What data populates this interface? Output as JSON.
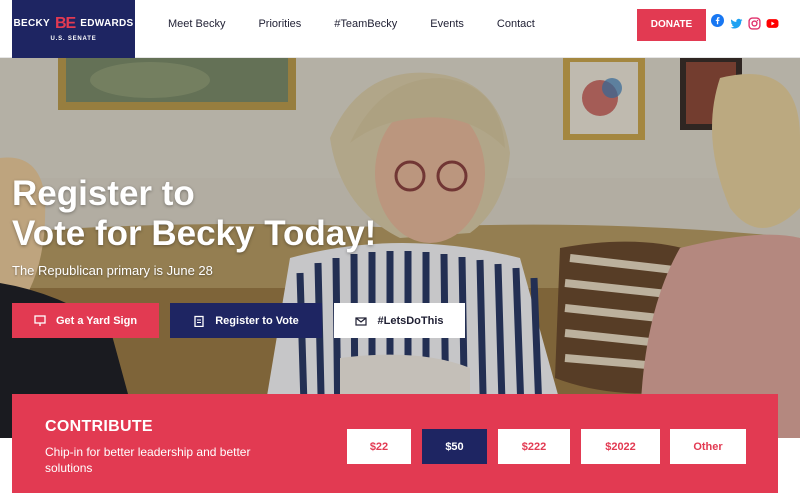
{
  "header": {
    "logo": {
      "first": "BECKY",
      "mark": "BE",
      "last": "EDWARDS",
      "sub": "U.S. SENATE"
    },
    "nav": [
      "Meet Becky",
      "Priorities",
      "#TeamBecky",
      "Events",
      "Contact"
    ],
    "donate_label": "DONATE",
    "social": [
      {
        "name": "facebook-icon",
        "color": "#1877f2"
      },
      {
        "name": "twitter-icon",
        "color": "#1da1f2"
      },
      {
        "name": "instagram-icon",
        "color": "#e1306c"
      },
      {
        "name": "youtube-icon",
        "color": "#ff0000"
      }
    ]
  },
  "hero": {
    "title_line1": "Register to",
    "title_line2": "Vote for Becky Today!",
    "subtitle": "The Republican primary is June 28",
    "buttons": [
      {
        "label": "Get a Yard Sign",
        "icon": "sign-icon"
      },
      {
        "label": "Register to Vote",
        "icon": "clipboard-icon"
      },
      {
        "label": "#LetsDoThis",
        "icon": "envelope-icon"
      }
    ]
  },
  "contribute": {
    "title": "CONTRIBUTE",
    "text": "Chip-in for better leadership and better solutions",
    "amounts": [
      "$22",
      "$50",
      "$222",
      "$2022",
      "Other"
    ],
    "selected": "$50"
  },
  "colors": {
    "brand_red": "#e23a52",
    "brand_navy": "#1e2562"
  }
}
